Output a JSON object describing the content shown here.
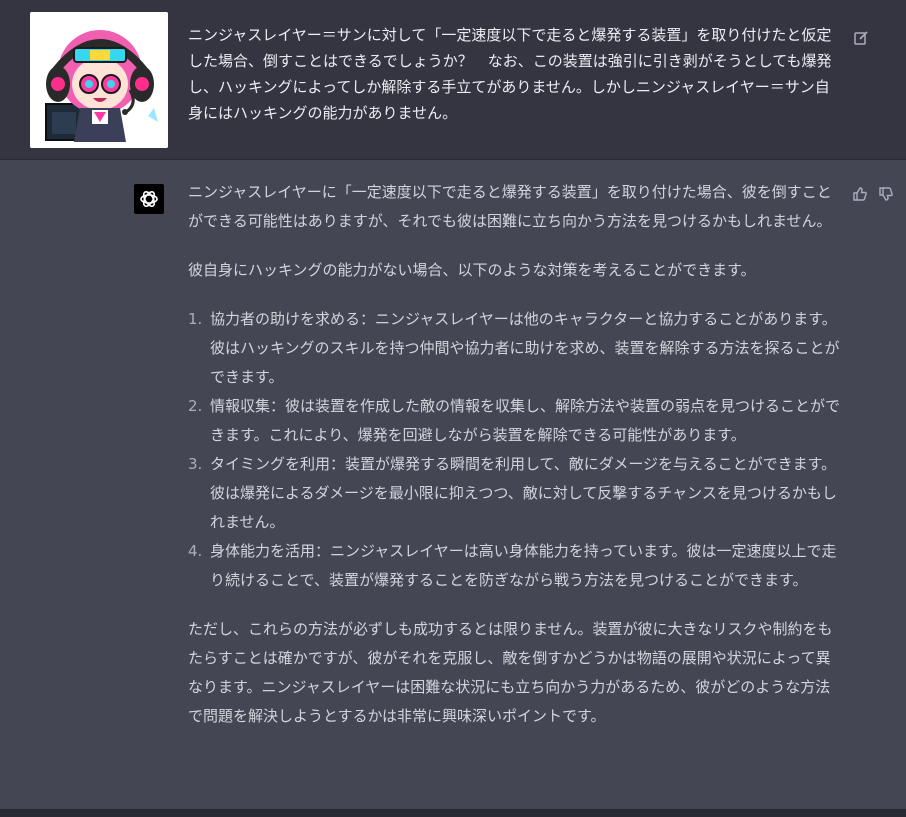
{
  "user_message": {
    "avatar": "anime-character-avatar",
    "text": "ニンジャスレイヤー＝サンに対して「一定速度以下で走ると爆発する装置」を取り付けたと仮定した場合、倒すことはできるでしょうか？　なお、この装置は強引に引き剥がそうとしても爆発し、ハッキングによってしか解除する手立てがありません。しかしニンジャスレイヤー＝サン自身にはハッキングの能力がありません。",
    "edit_icon": "edit-icon"
  },
  "assistant_message": {
    "avatar": "openai-logo-icon",
    "intro": "ニンジャスレイヤーに「一定速度以下で走ると爆発する装置」を取り付けた場合、彼を倒すことができる可能性はありますが、それでも彼は困難に立ち向かう方法を見つけるかもしれません。",
    "lead": "彼自身にハッキングの能力がない場合、以下のような対策を考えることができます。",
    "items": [
      {
        "num": "1.",
        "text": "協力者の助けを求める：ニンジャスレイヤーは他のキャラクターと協力することがあります。彼はハッキングのスキルを持つ仲間や協力者に助けを求め、装置を解除する方法を探ることができます。"
      },
      {
        "num": "2.",
        "text": "情報収集：彼は装置を作成した敵の情報を収集し、解除方法や装置の弱点を見つけることができます。これにより、爆発を回避しながら装置を解除できる可能性があります。"
      },
      {
        "num": "3.",
        "text": "タイミングを利用：装置が爆発する瞬間を利用して、敵にダメージを与えることができます。彼は爆発によるダメージを最小限に抑えつつ、敵に対して反撃するチャンスを見つけるかもしれません。"
      },
      {
        "num": "4.",
        "text": "身体能力を活用：ニンジャスレイヤーは高い身体能力を持っています。彼は一定速度以上で走り続けることで、装置が爆発することを防ぎながら戦う方法を見つけることができます。"
      }
    ],
    "conclusion": "ただし、これらの方法が必ずしも成功するとは限りません。装置が彼に大きなリスクや制約をもたらすことは確かですが、彼がそれを克服し、敵を倒すかどうかは物語の展開や状況によって異なります。ニンジャスレイヤーは困難な状況にも立ち向かう力があるため、彼がどのような方法で問題を解決しようとするかは非常に興味深いポイントです。",
    "thumbs_up_icon": "thumbs-up-icon",
    "thumbs_down_icon": "thumbs-down-icon"
  },
  "colors": {
    "user_bg": "#343541",
    "assistant_bg": "#444654",
    "text": "#d1d5db",
    "icon": "#acacbe"
  }
}
